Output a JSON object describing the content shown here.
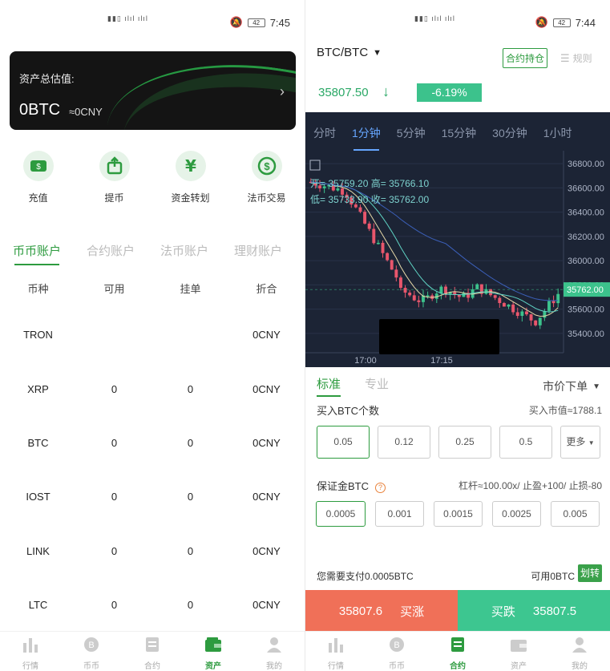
{
  "left": {
    "status": {
      "time": "7:45",
      "battery": "42"
    },
    "asset_card": {
      "title": "资产总估值:",
      "value": "0BTC",
      "cny": "≈0CNY"
    },
    "actions": [
      {
        "label": "充值",
        "icon": "deposit-icon"
      },
      {
        "label": "提币",
        "icon": "withdraw-icon"
      },
      {
        "label": "资金转划",
        "icon": "transfer-icon"
      },
      {
        "label": "法币交易",
        "icon": "fiat-trade-icon"
      }
    ],
    "account_tabs": [
      "币币账户",
      "合约账户",
      "法币账户",
      "理财账户"
    ],
    "table": {
      "headers": [
        "币种",
        "可用",
        "挂单",
        "折合"
      ],
      "rows": [
        [
          "TRON",
          "",
          "",
          "0CNY"
        ],
        [
          "XRP",
          "0",
          "0",
          "0CNY"
        ],
        [
          "BTC",
          "0",
          "0",
          "0CNY"
        ],
        [
          "IOST",
          "0",
          "0",
          "0CNY"
        ],
        [
          "LINK",
          "0",
          "0",
          "0CNY"
        ],
        [
          "LTC",
          "0",
          "0",
          "0CNY"
        ]
      ]
    },
    "nav": [
      "行情",
      "币币",
      "合约",
      "资产",
      "我的"
    ]
  },
  "right": {
    "status": {
      "time": "7:44",
      "battery": "42"
    },
    "pair": "BTC/BTC",
    "contract_btn": "合约持仓",
    "rules": "规则",
    "price": "35807.50",
    "change_pct": "-6.19%",
    "periods": [
      "分时",
      "1分钟",
      "5分钟",
      "15分钟",
      "30分钟",
      "1小时"
    ],
    "ohlc": {
      "open": "开= 35759.20",
      "high": "高= 35766.10",
      "low": "低= 35733.90",
      "close": "收= 35762.00"
    },
    "chart_data": {
      "type": "candlestick",
      "y_ticks": [
        "36800.00",
        "36600.00",
        "36400.00",
        "36200.00",
        "36000.00",
        "35800.00",
        "35600.00",
        "35400.00"
      ],
      "x_ticks": [
        "17:00",
        "17:15"
      ],
      "current_price_label": "35762.00",
      "ylim": [
        35320,
        36880
      ]
    },
    "form": {
      "modes": [
        "标准",
        "专业"
      ],
      "order_type": "市价下单",
      "buy_label": "买入BTC个数",
      "buy_hint": "买入市值≈1788.1",
      "amounts": [
        "0.05",
        "0.12",
        "0.25",
        "0.5"
      ],
      "more": "更多",
      "margin_label": "保证金BTC",
      "margin_hint": "杠杆≈100.00x/ 止盈+100/ 止损-80",
      "margins": [
        "0.0005",
        "0.001",
        "0.0015",
        "0.0025",
        "0.005"
      ],
      "pay": "您需要支付0.0005BTC",
      "available": "可用0BTC",
      "transfer": "划转",
      "buy_up_price": "35807.6",
      "buy_up": "买涨",
      "buy_down": "买跌",
      "buy_down_price": "35807.5"
    },
    "nav": [
      "行情",
      "币币",
      "合约",
      "资产",
      "我的"
    ]
  }
}
